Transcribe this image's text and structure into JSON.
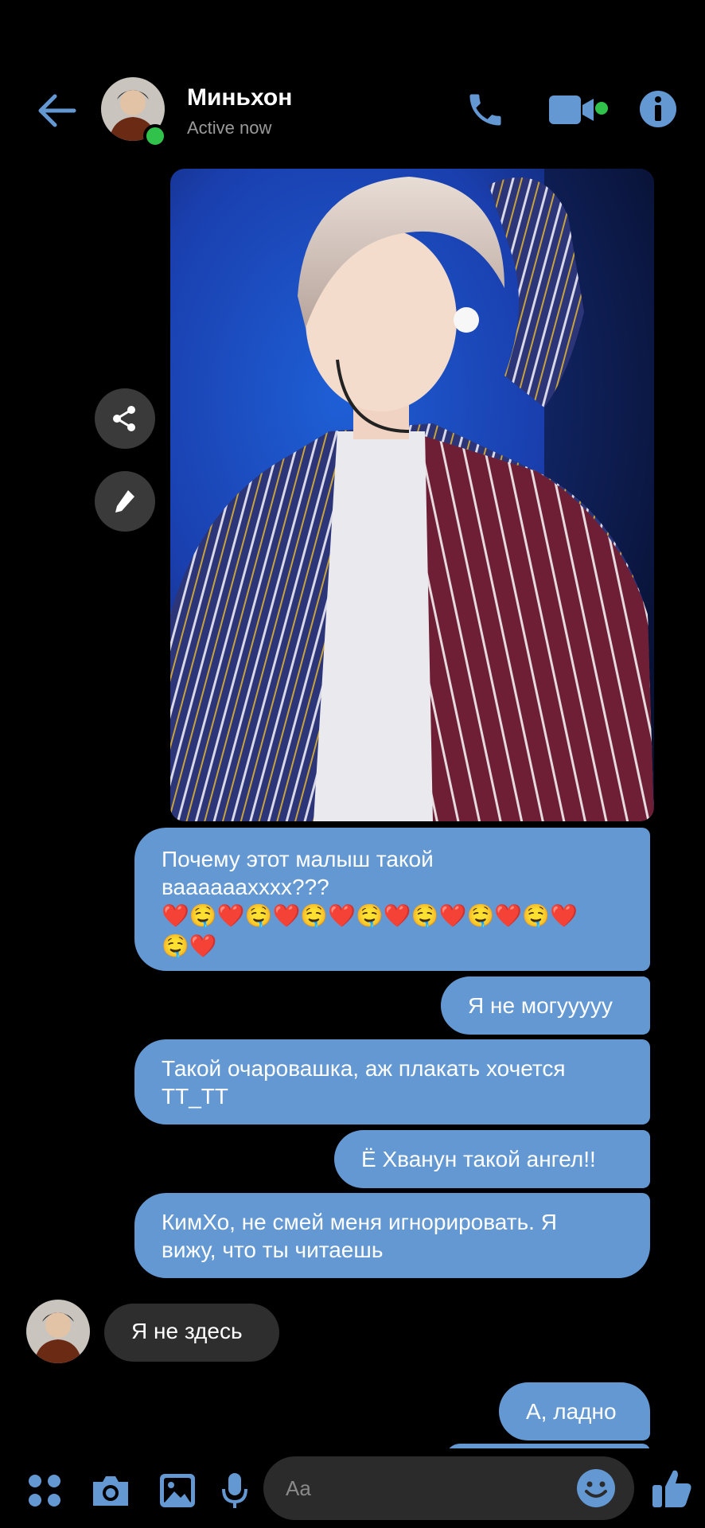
{
  "header": {
    "contact_name": "Миньхон",
    "status": "Active now"
  },
  "icons": {
    "back": "arrow-left-icon",
    "call": "phone-icon",
    "video": "video-camera-icon",
    "info": "info-icon",
    "share": "share-icon",
    "edit": "pencil-icon",
    "apps": "apps-grid-icon",
    "camera": "camera-icon",
    "gallery": "image-icon",
    "mic": "microphone-icon",
    "emoji": "smiley-icon",
    "like": "thumbs-up-icon"
  },
  "colors": {
    "accent": "#6398d3",
    "outgoing_bubble": "#6398d3",
    "incoming_bubble": "#2e2e2e",
    "online": "#31c24c",
    "background": "#000000"
  },
  "messages": {
    "m1_line1": "Почему этот малыш такой",
    "m1_line2": "вааааааxxxx???",
    "m1_emoji_line1": "❤️🤤❤️🤤❤️🤤❤️🤤❤️🤤❤️🤤❤️🤤❤️",
    "m1_emoji_line2": "🤤❤️",
    "m2": "Я не могууууу",
    "m3_line1": "Такой очаровашка, аж плакать хочется",
    "m3_line2": "TT_TT",
    "m4": "Ё Хванун такой ангел!!",
    "m5_line1": "КимХо, не смей меня игнорировать. Я",
    "m5_line2": "вижу, что ты читаешь",
    "incoming": "Я не здесь",
    "m6": "А, ладно"
  },
  "composer": {
    "placeholder": "Aa"
  }
}
